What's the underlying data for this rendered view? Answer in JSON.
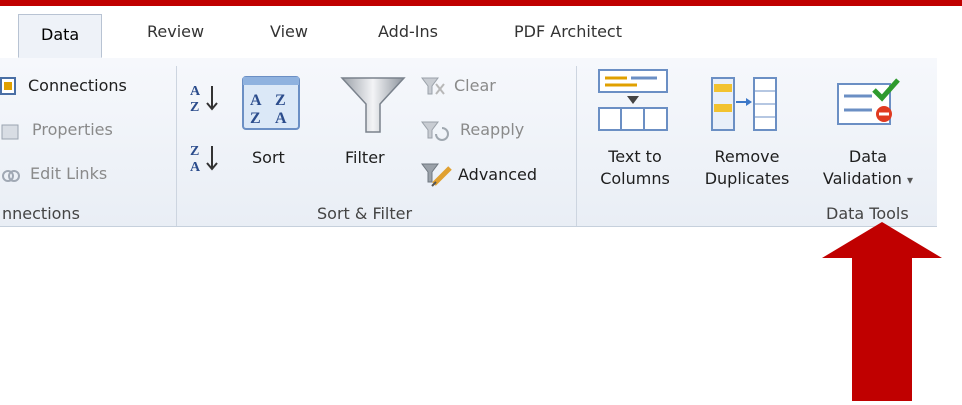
{
  "tabs": [
    "Data",
    "Review",
    "View",
    "Add-Ins",
    "PDF Architect"
  ],
  "connections_group": {
    "label": "nnections",
    "items": [
      "Connections",
      "Properties",
      "Edit Links"
    ]
  },
  "sort_filter_group": {
    "label": "Sort & Filter",
    "sort_label": "Sort",
    "filter_label": "Filter",
    "clear_label": "Clear",
    "reapply_label": "Reapply",
    "advanced_label": "Advanced"
  },
  "data_tools_group": {
    "label": "Data Tools",
    "text_to_columns": [
      "Text to",
      "Columns"
    ],
    "remove_duplicates": [
      "Remove",
      "Duplicates"
    ],
    "data_validation": [
      "Data",
      "Validation"
    ],
    "dropdown_glyph": "▾"
  },
  "colors": {
    "accent_red": "#c00000",
    "ribbon_bg": "#eef2f8"
  }
}
